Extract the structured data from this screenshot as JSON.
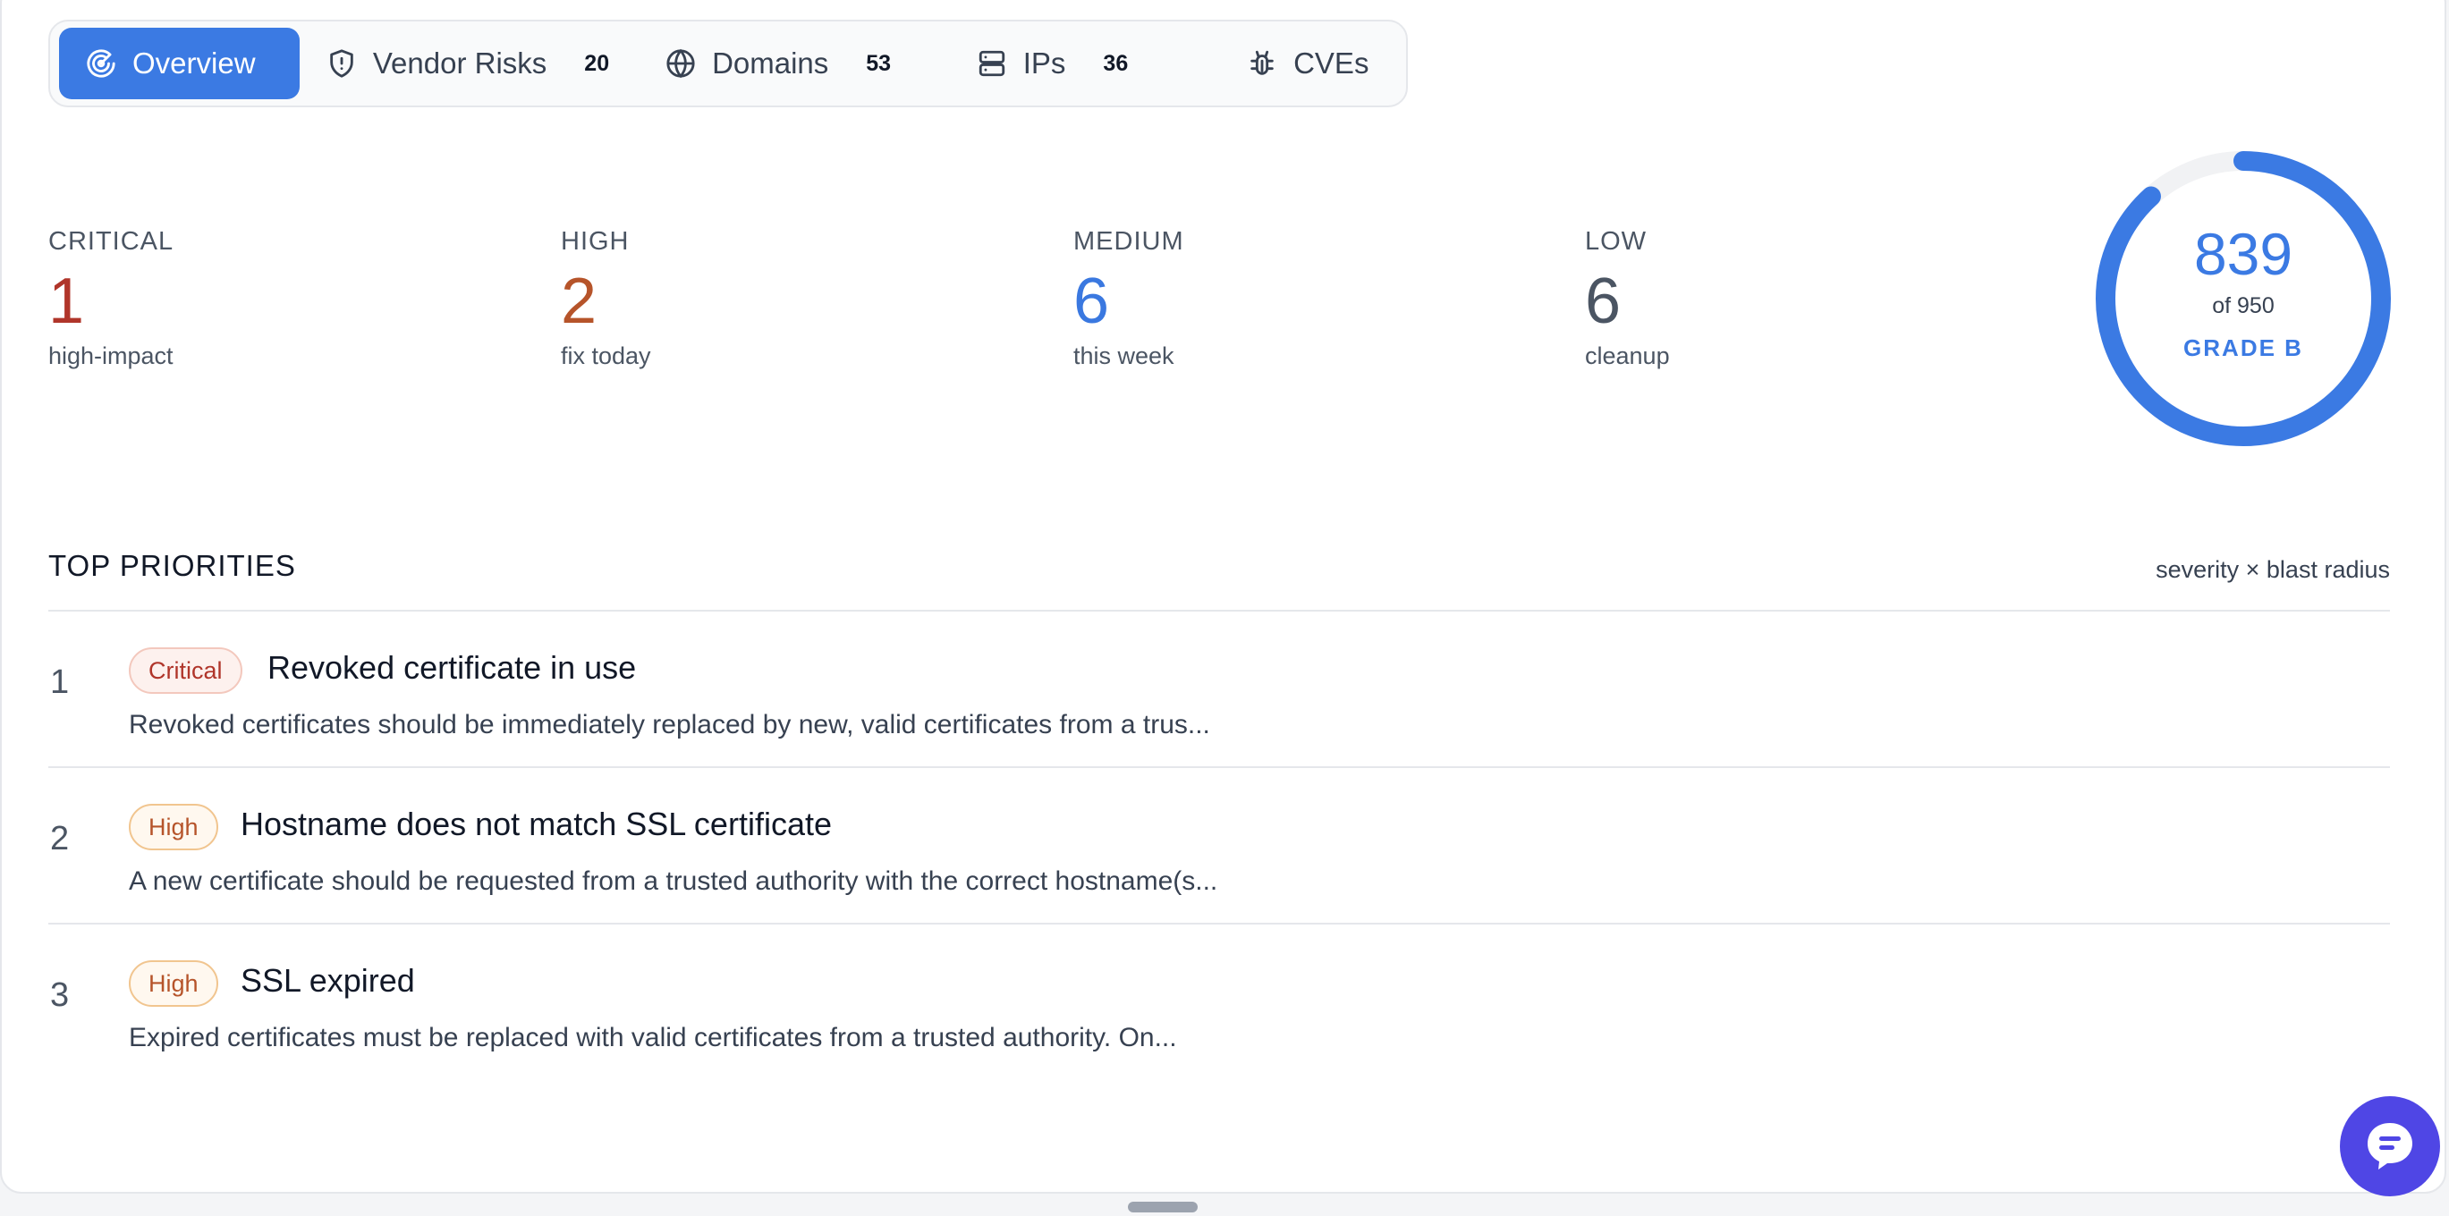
{
  "tabs": [
    {
      "label": "Overview",
      "icon": "radar-icon",
      "active": true
    },
    {
      "label": "Vendor Risks",
      "icon": "shield-icon",
      "count": "20"
    },
    {
      "label": "Domains",
      "icon": "globe-icon",
      "count": "53"
    },
    {
      "label": "IPs",
      "icon": "server-icon",
      "count": "36"
    },
    {
      "label": "CVEs",
      "icon": "bug-icon"
    }
  ],
  "severity": {
    "critical": {
      "label": "CRITICAL",
      "value": "1",
      "sub": "high-impact",
      "color": "#b0352a"
    },
    "high": {
      "label": "HIGH",
      "value": "2",
      "sub": "fix today",
      "color": "#b6542a"
    },
    "medium": {
      "label": "MEDIUM",
      "value": "6",
      "sub": "this week",
      "color": "#3a78e0"
    },
    "low": {
      "label": "LOW",
      "value": "6",
      "sub": "cleanup",
      "color": "#4b5563"
    }
  },
  "score": {
    "value": "839",
    "max": "of 950",
    "grade": "GRADE B",
    "fraction": 0.883,
    "color": "#3b7ae3"
  },
  "priorities": {
    "title": "TOP PRIORITIES",
    "note": "severity × blast radius",
    "items": [
      {
        "rank": "1",
        "severity": "Critical",
        "title": "Revoked certificate in use",
        "desc": "Revoked certificates should be immediately replaced by new, valid certificates from a trus..."
      },
      {
        "rank": "2",
        "severity": "High",
        "title": "Hostname does not match SSL certificate",
        "desc": "A new certificate should be requested from a trusted authority with the correct hostname(s..."
      },
      {
        "rank": "3",
        "severity": "High",
        "title": "SSL expired",
        "desc": "Expired certificates must be replaced with valid certificates from a trusted authority. On..."
      }
    ]
  },
  "chat": {
    "icon": "chat-icon",
    "color": "#4f46e5"
  }
}
